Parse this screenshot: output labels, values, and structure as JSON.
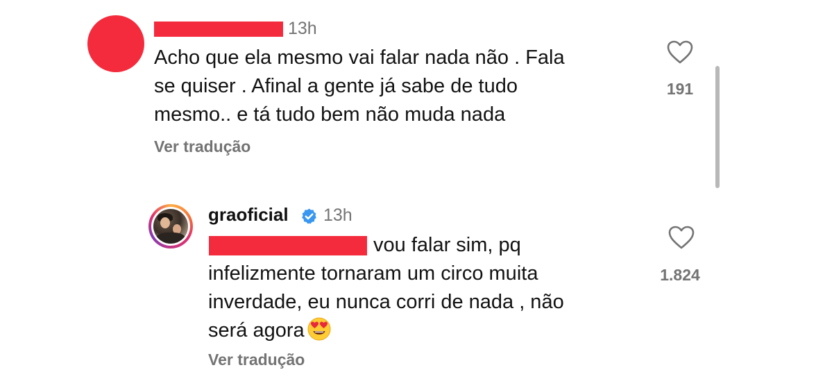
{
  "comments": [
    {
      "timestamp": "13h",
      "text": "Acho que ela mesmo vai falar nada não . Fala\nse quiser . Afinal a gente já sabe de tudo\nmesmo.. e tá tudo bem não muda nada",
      "translate_label": "Ver tradução",
      "likes": "191",
      "like_icon": "heart-outline-icon"
    }
  ],
  "reply": {
    "username": "graoficial",
    "verified_icon": "verified-badge-icon",
    "timestamp": "13h",
    "text_first_line": "vou falar sim, pq",
    "text_rest": "infelizmente tornaram um circo  muita\ninverdade, eu nunca corri de nada , não\nserá agora",
    "emoji": "heart-eyes-emoji",
    "translate_label": "Ver tradução",
    "likes": "1.824",
    "like_icon": "heart-outline-icon"
  },
  "colors": {
    "redaction": "#f42b3c",
    "muted_text": "#737373",
    "verified_blue": "#3897f0"
  }
}
